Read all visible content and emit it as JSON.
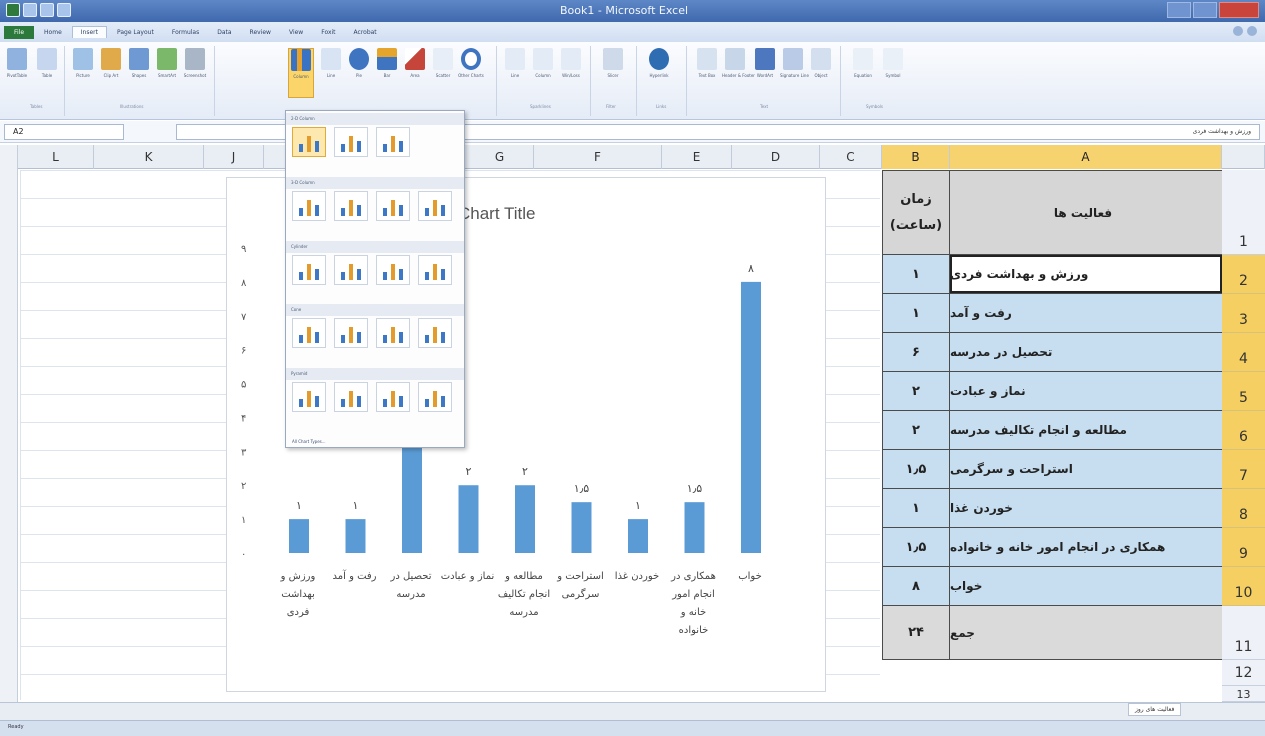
{
  "window": {
    "title": "Book1 - Microsoft Excel"
  },
  "tabs": [
    {
      "label": "File"
    },
    {
      "label": "Home"
    },
    {
      "label": "Insert"
    },
    {
      "label": "Page Layout"
    },
    {
      "label": "Formulas"
    },
    {
      "label": "Data"
    },
    {
      "label": "Review"
    },
    {
      "label": "View"
    },
    {
      "label": "Foxit"
    },
    {
      "label": "Acrobat"
    }
  ],
  "ribbon": {
    "buttons": [
      "PivotTable",
      "Table",
      "Picture",
      "Clip Art",
      "Shapes",
      "SmartArt",
      "Screenshot",
      "Column",
      "Line",
      "Pie",
      "Bar",
      "Area",
      "Scatter",
      "Other Charts",
      "Line",
      "Column",
      "Win/Loss",
      "Slicer",
      "Hyperlink",
      "Text Box",
      "Header & Footer",
      "WordArt",
      "Signature Line",
      "Object",
      "Equation",
      "Symbol"
    ],
    "groups": [
      "Tables",
      "Illustrations",
      "Sparklines",
      "Filter",
      "Links",
      "Text",
      "Symbols"
    ]
  },
  "formula_bar": {
    "name_box": "A2",
    "value": "ورزش و بهداشت فردی"
  },
  "columns": [
    "L",
    "K",
    "J",
    "G",
    "F",
    "E",
    "D",
    "C",
    "B",
    "A"
  ],
  "rows": [
    "1",
    "2",
    "3",
    "4",
    "5",
    "6",
    "7",
    "8",
    "9",
    "10",
    "11",
    "12",
    "13"
  ],
  "table": {
    "header": {
      "activity": "فعالیت ها",
      "time": "زمان\n(ساعت)"
    },
    "rows": [
      {
        "activity": "ورزش و بهداشت فردی",
        "time": "۱"
      },
      {
        "activity": "رفت و آمد",
        "time": "۱"
      },
      {
        "activity": "تحصیل در مدرسه",
        "time": "۶"
      },
      {
        "activity": "نماز و عبادت",
        "time": "۲"
      },
      {
        "activity": "مطالعه و انجام تکالیف مدرسه",
        "time": "۲"
      },
      {
        "activity": "استراحت و سرگرمی",
        "time": "۱٫۵"
      },
      {
        "activity": "خوردن غذا",
        "time": "۱"
      },
      {
        "activity": "همکاری در انجام امور خانه و خانواده",
        "time": "۱٫۵"
      },
      {
        "activity": "خواب",
        "time": "۸"
      }
    ],
    "total": {
      "activity": "جمع",
      "time": "۲۴"
    }
  },
  "gallery": {
    "sections": [
      "2-D Column",
      "3-D Column",
      "Cylinder",
      "Cone",
      "Pyramid"
    ],
    "footer": "All Chart Types..."
  },
  "chart_data": {
    "type": "bar",
    "title": "Chart Title",
    "categories": [
      "ورزش و بهداشت فردی",
      "رفت و آمد",
      "تحصیل در مدرسه",
      "نماز و عبادت",
      "مطالعه و انجام تکالیف مدرسه",
      "استراحت و سرگرمی",
      "خوردن غذا",
      "همکاری در انجام امور خانه و خانواده",
      "خواب"
    ],
    "values": [
      1,
      1,
      6,
      2,
      2,
      1.5,
      1,
      1.5,
      8
    ],
    "value_labels": [
      "۱",
      "۱",
      "",
      "۲",
      "۲",
      "۱٫۵",
      "۱",
      "۱٫۵",
      "۸"
    ],
    "y_ticks": [
      "۰",
      "۱",
      "۲",
      "۳",
      "۴",
      "۵",
      "۶",
      "۷",
      "۸",
      "۹"
    ],
    "ylim": [
      0,
      9
    ],
    "bar_color": "#5b9bd5"
  },
  "status": {
    "ready": "Ready",
    "sheet_tab": "فعالیت های روز"
  }
}
